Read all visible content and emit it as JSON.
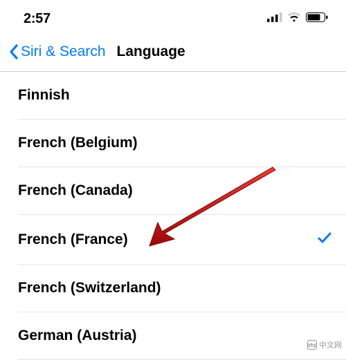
{
  "status_bar": {
    "time": "2:57"
  },
  "nav": {
    "back_label": "Siri & Search",
    "title": "Language"
  },
  "languages": [
    {
      "label": "Finnish",
      "selected": false
    },
    {
      "label": "French (Belgium)",
      "selected": false
    },
    {
      "label": "French (Canada)",
      "selected": false
    },
    {
      "label": "French (France)",
      "selected": true
    },
    {
      "label": "French (Switzerland)",
      "selected": false
    },
    {
      "label": "German (Austria)",
      "selected": false
    }
  ],
  "watermark": {
    "text": "中文网",
    "logo": "php"
  },
  "colors": {
    "accent": "#007aff",
    "bg": "#f2f2f7",
    "separator": "#e5e5ea"
  }
}
